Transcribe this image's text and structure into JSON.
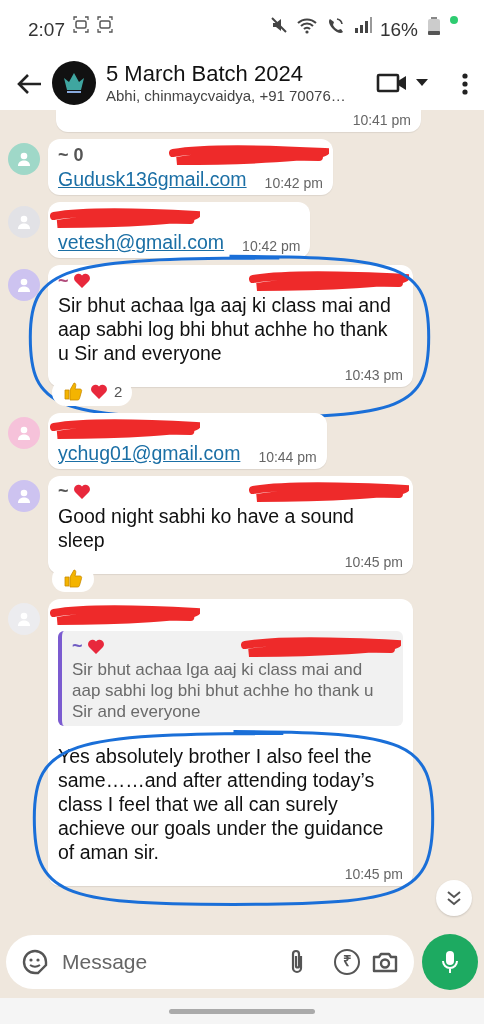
{
  "status_bar": {
    "time": "2:07",
    "battery": "16%"
  },
  "header": {
    "title": "5 March Batch 2024",
    "subtitle": "Abhi, chinmaycvaidya, +91 70076…"
  },
  "messages": [
    {
      "kind": "partial",
      "time": "10:41 pm"
    },
    {
      "kind": "message",
      "color": "#9fd8c8",
      "sender": "~ 0",
      "redacted": true,
      "text": "Gudusk136gmail.com",
      "link": true,
      "time": "10:42 pm"
    },
    {
      "kind": "message",
      "color": "#e2e2e6",
      "redacted": true,
      "text": "vetesh@gmail.com",
      "link": true,
      "time": "10:42 pm"
    },
    {
      "kind": "message",
      "color": "#cdc3f0",
      "sender": "~",
      "sender_heart": true,
      "redacted": true,
      "text": "Sir bhut achaa lga aaj ki class mai and aap sabhi log bhi bhut achhe ho thank u Sir and everyone",
      "time": "10:43 pm",
      "highlighted": true,
      "reactions": [
        {
          "kind": "thumbs_up"
        },
        {
          "kind": "heart"
        }
      ],
      "reaction_count": "2"
    },
    {
      "kind": "message",
      "color": "#f6c2da",
      "redacted": true,
      "text": "ychug01@gmail.com",
      "link": true,
      "time": "10:44 pm"
    },
    {
      "kind": "message",
      "color": "#cdc3f0",
      "sender": "~",
      "sender_heart": true,
      "redacted": true,
      "text": "Good night sabhi ko have a sound sleep",
      "time": "10:45 pm",
      "reactions": [
        {
          "kind": "thumbs_up"
        }
      ]
    },
    {
      "kind": "message",
      "color": "#ececef",
      "redacted": true,
      "quote": {
        "sender": "~",
        "sender_heart": true,
        "redacted": true,
        "text": "Sir bhut achaa lga aaj ki class mai and aap sabhi log bhi bhut achhe ho thank u Sir and everyone"
      },
      "text": "Yes absolutely brother I also feel the same……and after attending today’s class I feel that we all can surely achieve our goals under the guidance of aman sir.",
      "time": "10:45 pm",
      "highlighted": true
    }
  ],
  "composer": {
    "placeholder": "Message",
    "currency": "₹"
  }
}
